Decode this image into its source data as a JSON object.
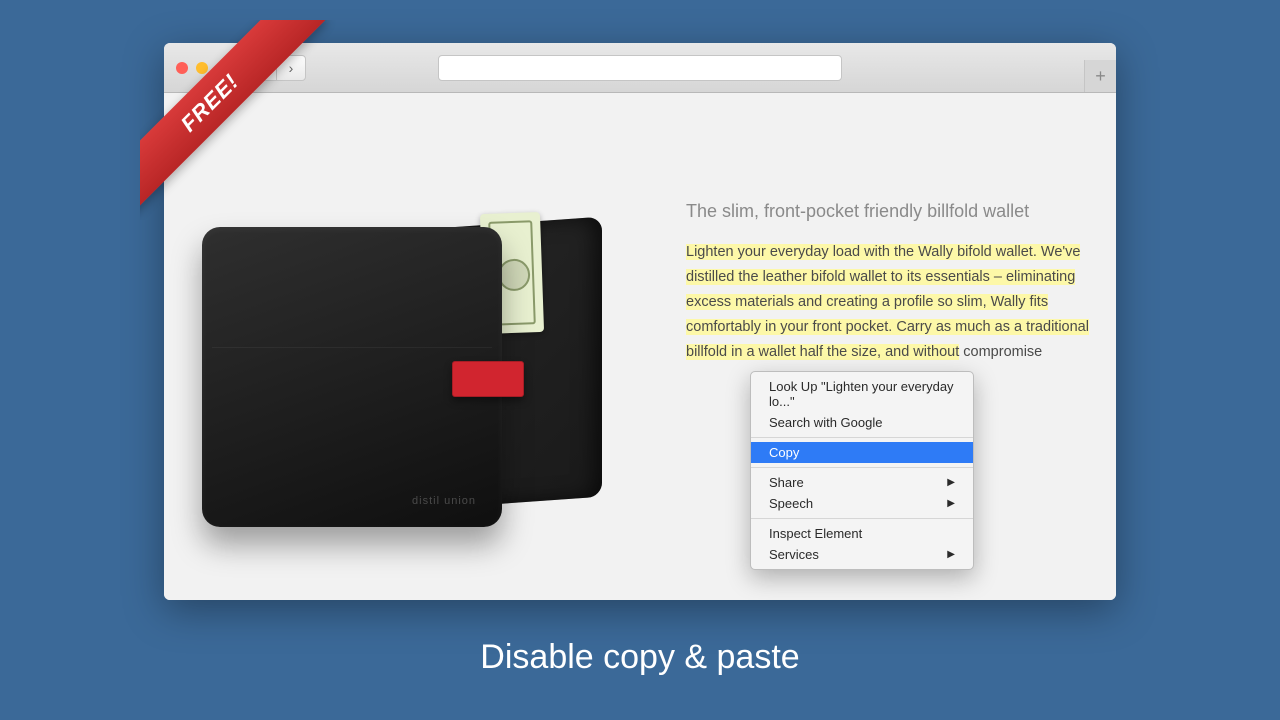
{
  "ribbon": {
    "text": "FREE!"
  },
  "browser": {
    "back_icon": "‹",
    "forward_icon": "›",
    "newtab_icon": "+"
  },
  "product": {
    "heading": "The slim, front-pocket friendly billfold wallet",
    "highlighted_text": "Lighten your everyday load with the Wally bifold wallet. We've distilled the leather bifold wallet to its essentials – eliminating excess materials and creating a profile so slim, Wally fits comfortably in your front pocket. Carry as much as a traditional billfold in a wallet half the size, and without",
    "tail_text": "compromise",
    "brand_emboss": "distil union"
  },
  "context_menu": {
    "lookup": "Look Up \"Lighten your everyday lo...\"",
    "search": "Search with Google",
    "copy": "Copy",
    "share": "Share",
    "speech": "Speech",
    "inspect": "Inspect Element",
    "services": "Services"
  },
  "caption": "Disable copy & paste"
}
